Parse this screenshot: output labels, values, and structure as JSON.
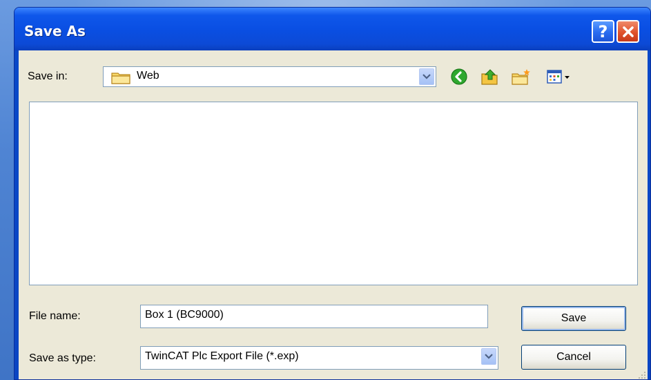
{
  "window": {
    "title": "Save As"
  },
  "titlebar": {
    "help_label": "?",
    "close_label": "✕"
  },
  "save_in": {
    "label": "Save in:",
    "value": "Web"
  },
  "toolbar": {
    "icons": [
      "back-icon",
      "up-folder-icon",
      "new-folder-icon",
      "view-menu-icon"
    ]
  },
  "file_name": {
    "label": "File name:",
    "value": "Box 1 (BC9000)"
  },
  "save_as_type": {
    "label": "Save as type:",
    "value": "TwinCAT Plc Export File (*.exp)"
  },
  "buttons": {
    "save_label": "Save",
    "cancel_label": "Cancel"
  },
  "colors": {
    "titlebar": "#0a4fe3",
    "dialog_body": "#ece9d8",
    "close": "#e0532c",
    "back_arrow": "#2fa82f"
  }
}
